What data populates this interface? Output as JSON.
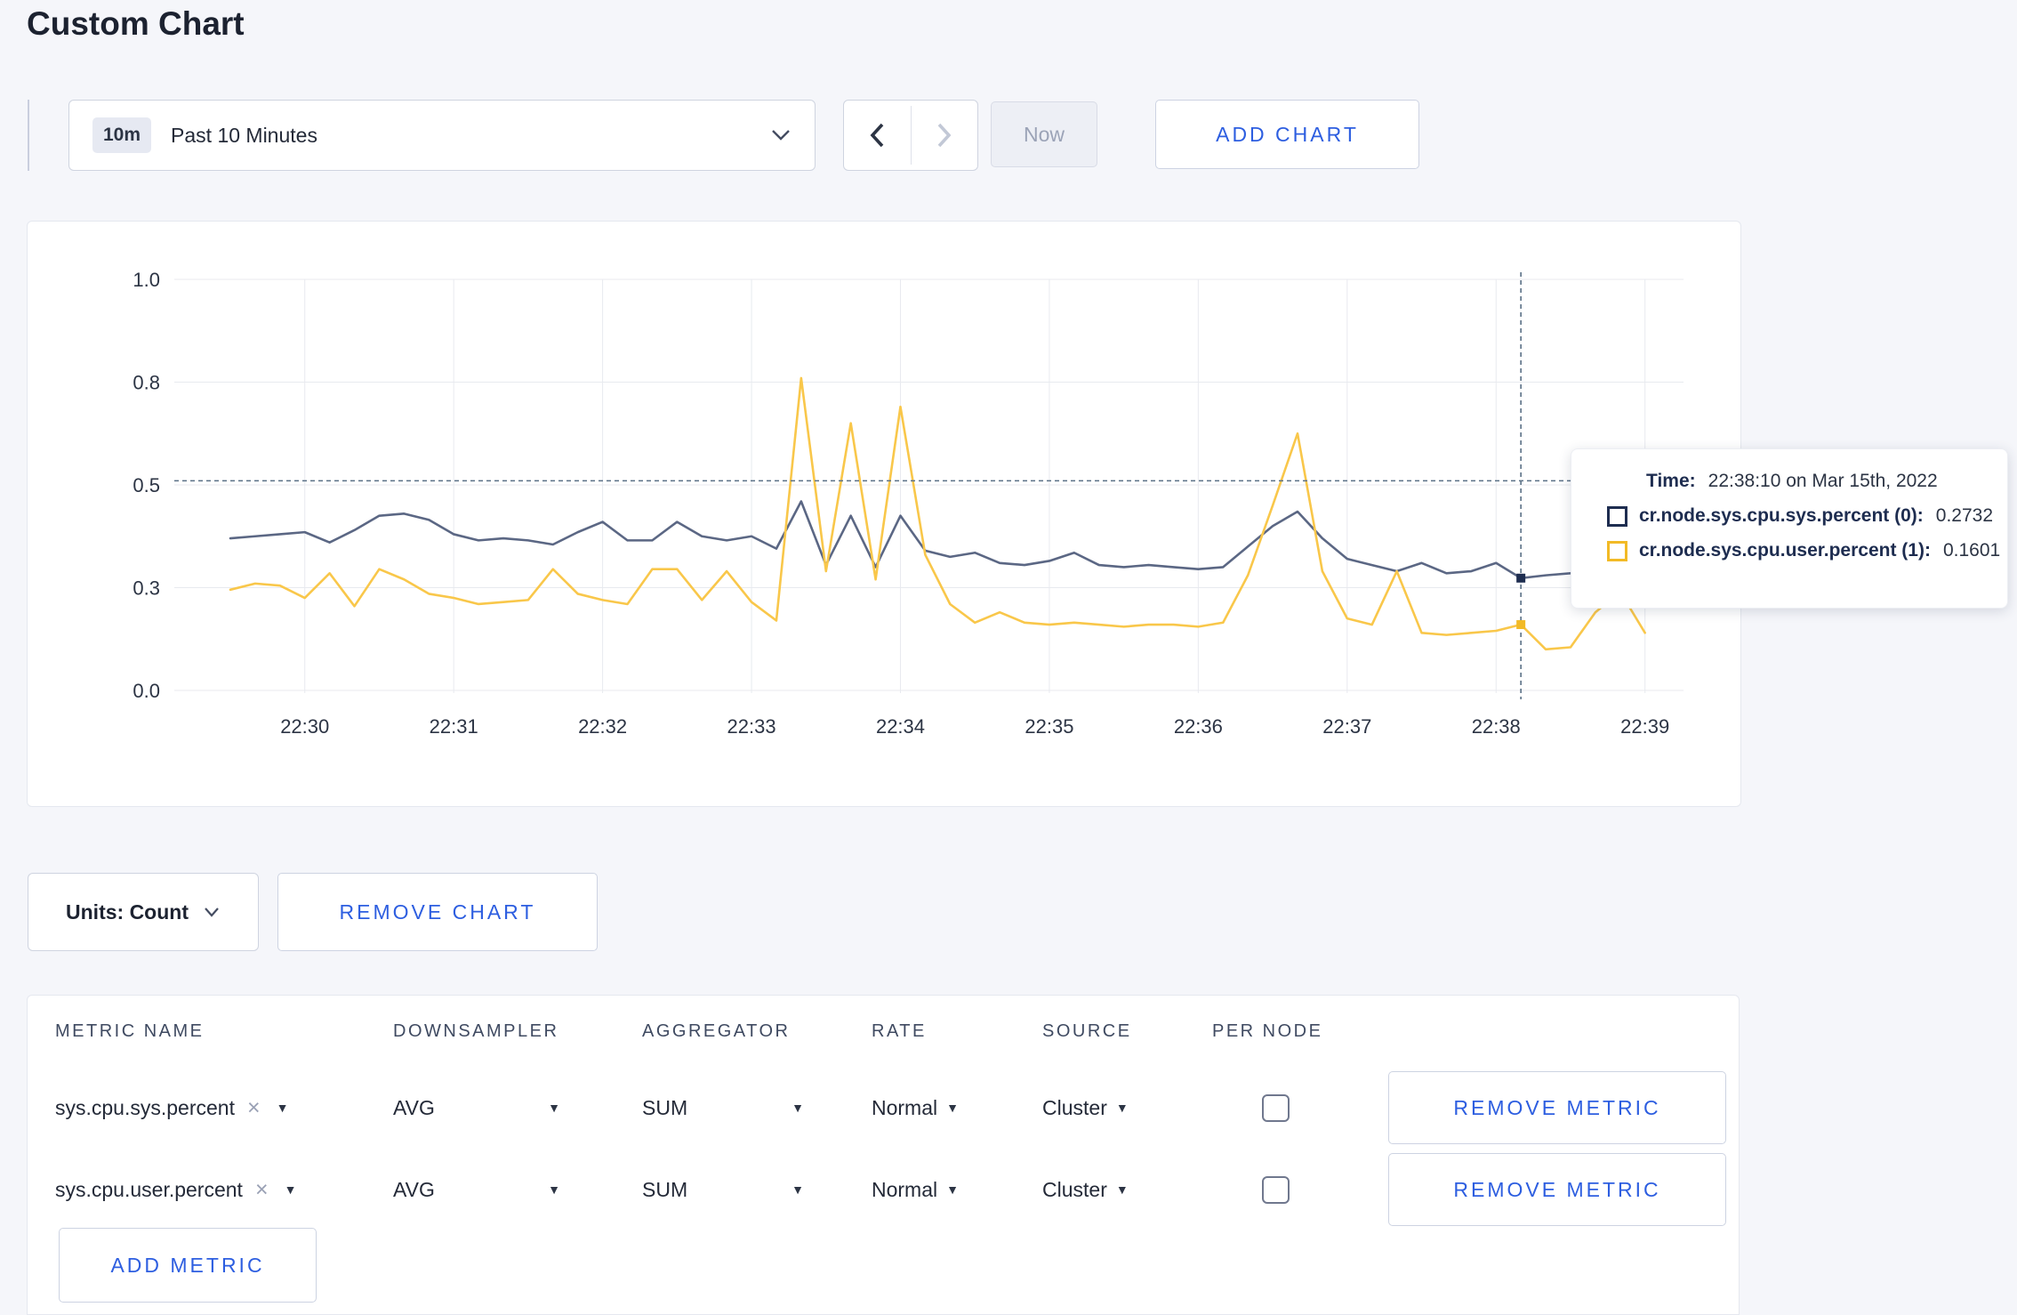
{
  "page": {
    "title": "Custom Chart"
  },
  "toolbar": {
    "range_badge": "10m",
    "range_label": "Past 10 Minutes",
    "now_label": "Now",
    "add_chart_label": "ADD CHART"
  },
  "tooltip": {
    "time_label": "Time:",
    "time_value": "22:38:10 on Mar 15th, 2022",
    "series": [
      {
        "label": "cr.node.sys.cpu.sys.percent (0):",
        "value": "0.2732",
        "swatch_color": "#1e2d50"
      },
      {
        "label": "cr.node.sys.cpu.user.percent (1):",
        "value": "0.1601",
        "swatch_color": "#f2ba26"
      }
    ]
  },
  "units": {
    "label": "Units: Count",
    "remove_chart_label": "REMOVE CHART"
  },
  "metrics_table": {
    "headers": [
      "METRIC NAME",
      "DOWNSAMPLER",
      "AGGREGATOR",
      "RATE",
      "SOURCE",
      "PER NODE"
    ],
    "rows": [
      {
        "name": "sys.cpu.sys.percent",
        "downsampler": "AVG",
        "aggregator": "SUM",
        "rate": "Normal",
        "source": "Cluster",
        "per_node_checked": false,
        "remove_label": "REMOVE METRIC"
      },
      {
        "name": "sys.cpu.user.percent",
        "downsampler": "AVG",
        "aggregator": "SUM",
        "rate": "Normal",
        "source": "Cluster",
        "per_node_checked": false,
        "remove_label": "REMOVE METRIC"
      }
    ],
    "add_metric_label": "ADD METRIC"
  },
  "chart_data": {
    "type": "line",
    "title": "",
    "xlabel": "",
    "ylabel": "",
    "ylim": [
      0,
      1
    ],
    "grid": true,
    "x_start_time": "22:29:30",
    "x_interval_seconds": 10,
    "x_tick_labels": [
      "22:30",
      "22:31",
      "22:32",
      "22:33",
      "22:34",
      "22:35",
      "22:36",
      "22:37",
      "22:38",
      "22:39"
    ],
    "y_tick_labels": [
      "0.0",
      "0.3",
      "0.5",
      "0.8",
      "1.0"
    ],
    "y_tick_values": [
      0,
      0.25,
      0.5,
      0.75,
      1.0
    ],
    "series": [
      {
        "name": "cr.node.sys.cpu.sys.percent",
        "color": "#5b6784",
        "swatch_color": "#1e2d50",
        "values": [
          0.37,
          0.375,
          0.38,
          0.385,
          0.36,
          0.39,
          0.425,
          0.43,
          0.415,
          0.38,
          0.365,
          0.37,
          0.365,
          0.355,
          0.385,
          0.41,
          0.365,
          0.365,
          0.41,
          0.375,
          0.365,
          0.375,
          0.345,
          0.46,
          0.305,
          0.425,
          0.3,
          0.425,
          0.34,
          0.325,
          0.335,
          0.31,
          0.305,
          0.315,
          0.335,
          0.305,
          0.3,
          0.305,
          0.3,
          0.295,
          0.3,
          0.35,
          0.4,
          0.435,
          0.37,
          0.32,
          0.305,
          0.29,
          0.31,
          0.285,
          0.29,
          0.31,
          0.2732,
          0.28,
          0.285,
          0.295,
          0.3,
          0.295
        ]
      },
      {
        "name": "cr.node.sys.cpu.user.percent",
        "color": "#f9c74a",
        "swatch_color": "#f2ba26",
        "values": [
          0.245,
          0.26,
          0.255,
          0.225,
          0.285,
          0.205,
          0.295,
          0.27,
          0.235,
          0.225,
          0.21,
          0.215,
          0.22,
          0.295,
          0.235,
          0.22,
          0.21,
          0.295,
          0.295,
          0.22,
          0.29,
          0.215,
          0.17,
          0.76,
          0.29,
          0.65,
          0.27,
          0.69,
          0.33,
          0.21,
          0.165,
          0.19,
          0.165,
          0.16,
          0.165,
          0.16,
          0.155,
          0.16,
          0.16,
          0.155,
          0.165,
          0.28,
          0.45,
          0.625,
          0.29,
          0.175,
          0.16,
          0.29,
          0.14,
          0.135,
          0.14,
          0.145,
          0.1601,
          0.1,
          0.105,
          0.19,
          0.24,
          0.14
        ]
      }
    ],
    "crosshair": {
      "time": "22:38:10",
      "index": 52,
      "h_line_value": 0.51,
      "point_values": [
        0.2732,
        0.1601
      ]
    },
    "legend_position": "tooltip-only"
  }
}
